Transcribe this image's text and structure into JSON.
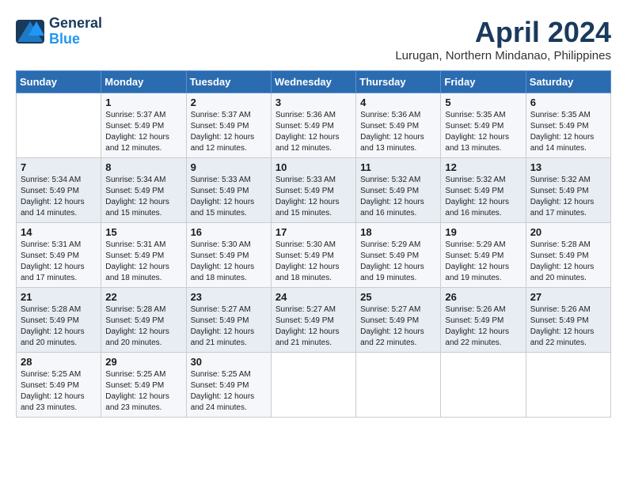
{
  "header": {
    "logo_line1": "General",
    "logo_line2": "Blue",
    "month_year": "April 2024",
    "location": "Lurugan, Northern Mindanao, Philippines"
  },
  "days_of_week": [
    "Sunday",
    "Monday",
    "Tuesday",
    "Wednesday",
    "Thursday",
    "Friday",
    "Saturday"
  ],
  "weeks": [
    [
      {
        "num": "",
        "info": ""
      },
      {
        "num": "1",
        "info": "Sunrise: 5:37 AM\nSunset: 5:49 PM\nDaylight: 12 hours\nand 12 minutes."
      },
      {
        "num": "2",
        "info": "Sunrise: 5:37 AM\nSunset: 5:49 PM\nDaylight: 12 hours\nand 12 minutes."
      },
      {
        "num": "3",
        "info": "Sunrise: 5:36 AM\nSunset: 5:49 PM\nDaylight: 12 hours\nand 12 minutes."
      },
      {
        "num": "4",
        "info": "Sunrise: 5:36 AM\nSunset: 5:49 PM\nDaylight: 12 hours\nand 13 minutes."
      },
      {
        "num": "5",
        "info": "Sunrise: 5:35 AM\nSunset: 5:49 PM\nDaylight: 12 hours\nand 13 minutes."
      },
      {
        "num": "6",
        "info": "Sunrise: 5:35 AM\nSunset: 5:49 PM\nDaylight: 12 hours\nand 14 minutes."
      }
    ],
    [
      {
        "num": "7",
        "info": "Sunrise: 5:34 AM\nSunset: 5:49 PM\nDaylight: 12 hours\nand 14 minutes."
      },
      {
        "num": "8",
        "info": "Sunrise: 5:34 AM\nSunset: 5:49 PM\nDaylight: 12 hours\nand 15 minutes."
      },
      {
        "num": "9",
        "info": "Sunrise: 5:33 AM\nSunset: 5:49 PM\nDaylight: 12 hours\nand 15 minutes."
      },
      {
        "num": "10",
        "info": "Sunrise: 5:33 AM\nSunset: 5:49 PM\nDaylight: 12 hours\nand 15 minutes."
      },
      {
        "num": "11",
        "info": "Sunrise: 5:32 AM\nSunset: 5:49 PM\nDaylight: 12 hours\nand 16 minutes."
      },
      {
        "num": "12",
        "info": "Sunrise: 5:32 AM\nSunset: 5:49 PM\nDaylight: 12 hours\nand 16 minutes."
      },
      {
        "num": "13",
        "info": "Sunrise: 5:32 AM\nSunset: 5:49 PM\nDaylight: 12 hours\nand 17 minutes."
      }
    ],
    [
      {
        "num": "14",
        "info": "Sunrise: 5:31 AM\nSunset: 5:49 PM\nDaylight: 12 hours\nand 17 minutes."
      },
      {
        "num": "15",
        "info": "Sunrise: 5:31 AM\nSunset: 5:49 PM\nDaylight: 12 hours\nand 18 minutes."
      },
      {
        "num": "16",
        "info": "Sunrise: 5:30 AM\nSunset: 5:49 PM\nDaylight: 12 hours\nand 18 minutes."
      },
      {
        "num": "17",
        "info": "Sunrise: 5:30 AM\nSunset: 5:49 PM\nDaylight: 12 hours\nand 18 minutes."
      },
      {
        "num": "18",
        "info": "Sunrise: 5:29 AM\nSunset: 5:49 PM\nDaylight: 12 hours\nand 19 minutes."
      },
      {
        "num": "19",
        "info": "Sunrise: 5:29 AM\nSunset: 5:49 PM\nDaylight: 12 hours\nand 19 minutes."
      },
      {
        "num": "20",
        "info": "Sunrise: 5:28 AM\nSunset: 5:49 PM\nDaylight: 12 hours\nand 20 minutes."
      }
    ],
    [
      {
        "num": "21",
        "info": "Sunrise: 5:28 AM\nSunset: 5:49 PM\nDaylight: 12 hours\nand 20 minutes."
      },
      {
        "num": "22",
        "info": "Sunrise: 5:28 AM\nSunset: 5:49 PM\nDaylight: 12 hours\nand 20 minutes."
      },
      {
        "num": "23",
        "info": "Sunrise: 5:27 AM\nSunset: 5:49 PM\nDaylight: 12 hours\nand 21 minutes."
      },
      {
        "num": "24",
        "info": "Sunrise: 5:27 AM\nSunset: 5:49 PM\nDaylight: 12 hours\nand 21 minutes."
      },
      {
        "num": "25",
        "info": "Sunrise: 5:27 AM\nSunset: 5:49 PM\nDaylight: 12 hours\nand 22 minutes."
      },
      {
        "num": "26",
        "info": "Sunrise: 5:26 AM\nSunset: 5:49 PM\nDaylight: 12 hours\nand 22 minutes."
      },
      {
        "num": "27",
        "info": "Sunrise: 5:26 AM\nSunset: 5:49 PM\nDaylight: 12 hours\nand 22 minutes."
      }
    ],
    [
      {
        "num": "28",
        "info": "Sunrise: 5:25 AM\nSunset: 5:49 PM\nDaylight: 12 hours\nand 23 minutes."
      },
      {
        "num": "29",
        "info": "Sunrise: 5:25 AM\nSunset: 5:49 PM\nDaylight: 12 hours\nand 23 minutes."
      },
      {
        "num": "30",
        "info": "Sunrise: 5:25 AM\nSunset: 5:49 PM\nDaylight: 12 hours\nand 24 minutes."
      },
      {
        "num": "",
        "info": ""
      },
      {
        "num": "",
        "info": ""
      },
      {
        "num": "",
        "info": ""
      },
      {
        "num": "",
        "info": ""
      }
    ]
  ]
}
